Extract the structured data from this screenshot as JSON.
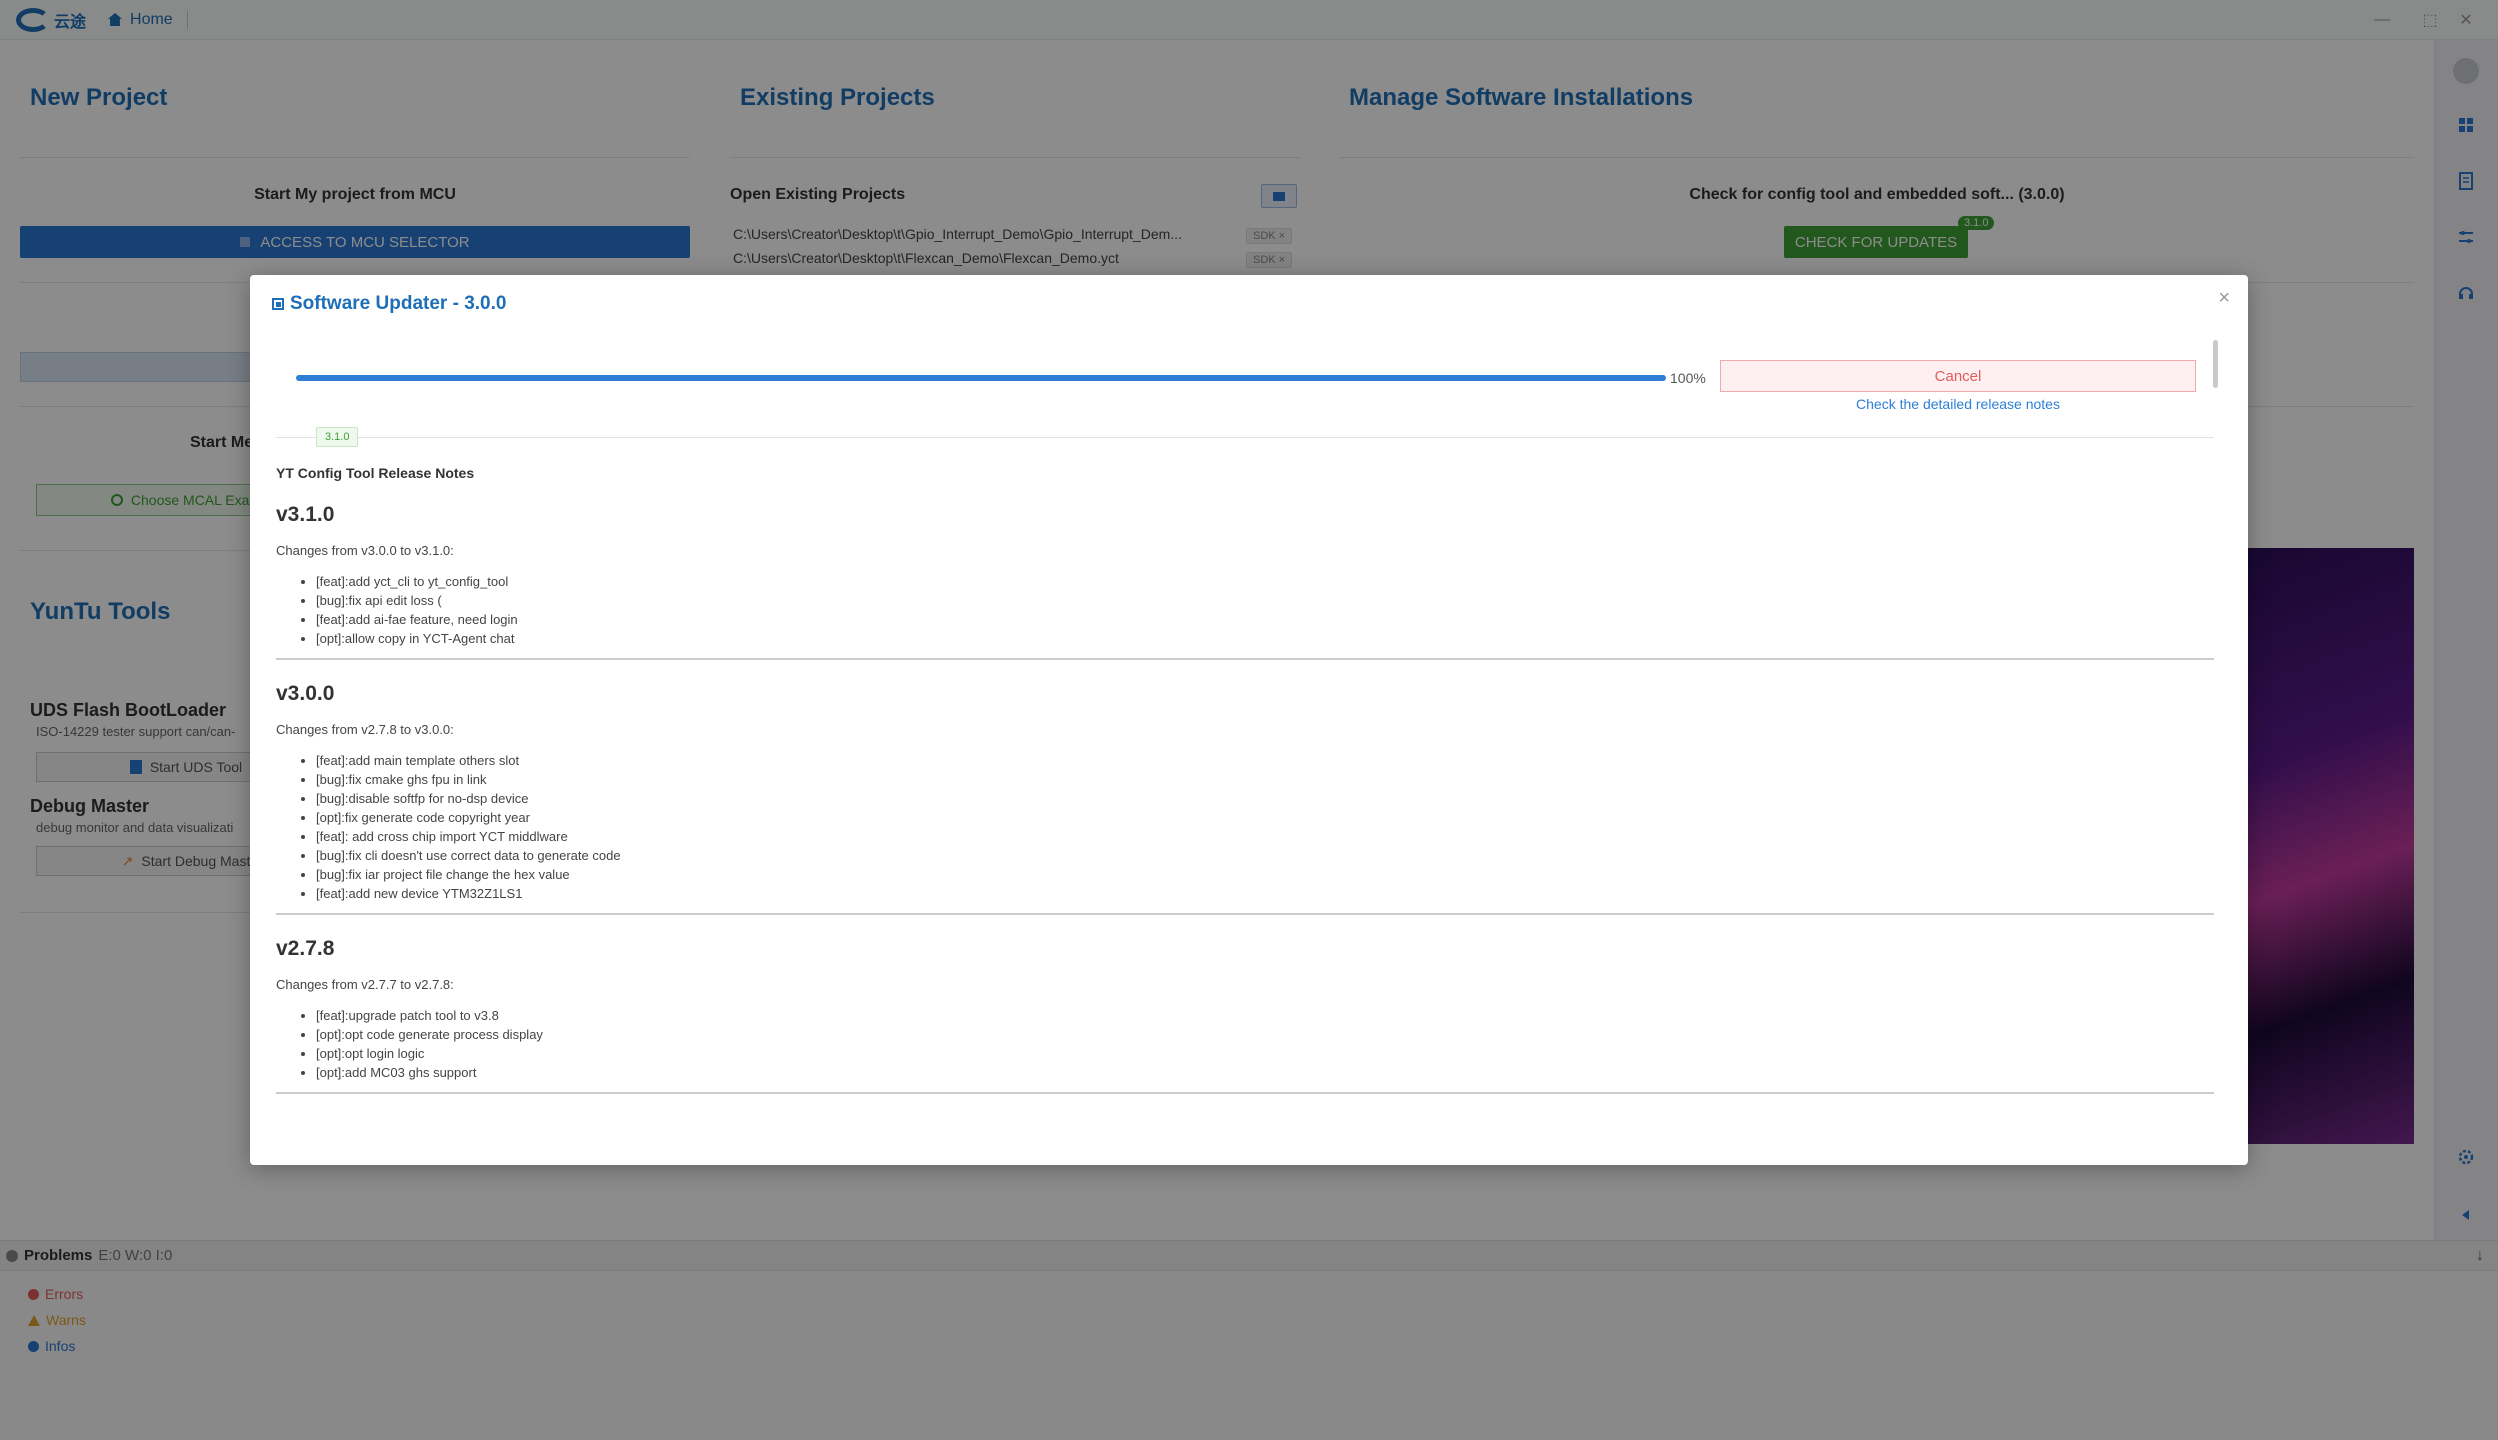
{
  "titlebar": {
    "logo_text": "云途",
    "home_label": "Home",
    "minimize": "—",
    "maximize": "⬚",
    "close": "✕"
  },
  "new_project": {
    "title": "New Project",
    "start_label": "Start My project from MCU",
    "mcu_button": "ACCESS TO MCU SELECTOR",
    "mcal_label": "Start Me",
    "mcal_button": "Choose MCAL Exam"
  },
  "existing_projects": {
    "title": "Existing Projects",
    "open_label": "Open Existing Projects",
    "projects": [
      {
        "path": "C:\\Users\\Creator\\Desktop\\t\\Gpio_Interrupt_Demo\\Gpio_Interrupt_Dem...",
        "tag": "SDK ×"
      },
      {
        "path": "C:\\Users\\Creator\\Desktop\\t\\Flexcan_Demo\\Flexcan_Demo.yct",
        "tag": "SDK ×"
      }
    ]
  },
  "manage_installations": {
    "title": "Manage Software Installations",
    "check_label": "Check for config tool and embedded soft... (3.0.0)",
    "check_button": "CHECK FOR UPDATES",
    "badge": "3.1.0"
  },
  "yuntu_tools": {
    "title": "YunTu Tools",
    "tools": [
      {
        "name": "UDS Flash BootLoader",
        "desc": "ISO-14229 tester support can/can-",
        "button": "Start UDS Tool"
      },
      {
        "name": "Debug Master",
        "desc": "debug monitor and data visualizati",
        "button": "Start Debug Mast"
      }
    ]
  },
  "problems": {
    "title": "Problems",
    "counts": "E:0 W:0 I:0",
    "errors": "Errors",
    "warns": "Warns",
    "infos": "Infos"
  },
  "dialog": {
    "title": "Software Updater - 3.0.0",
    "close": "×",
    "progress": 100,
    "progress_text": "100%",
    "cancel": "Cancel",
    "release_link": "Check the detailed release notes",
    "version_tag": "3.1.0",
    "notes_heading": "YT Config Tool Release Notes",
    "versions": [
      {
        "title": "v3.1.0",
        "changes": "Changes from v3.0.0 to v3.1.0:",
        "items": [
          "[feat]:add yct_cli to yt_config_tool",
          "[bug]:fix api edit loss (",
          "[feat]:add ai-fae feature, need login",
          "[opt]:allow copy in YCT-Agent chat"
        ]
      },
      {
        "title": "v3.0.0",
        "changes": "Changes from v2.7.8 to v3.0.0:",
        "items": [
          "[feat]:add main template others slot",
          "[bug]:fix cmake ghs fpu in link",
          "[bug]:disable softfp for no-dsp device",
          "[opt]:fix generate code copyright year",
          "[feat]: add cross chip import YCT middlware",
          "[bug]:fix cli doesn't use correct data to generate code",
          "[bug]:fix iar project file change the hex value",
          "[feat]:add new device YTM32Z1LS1"
        ]
      },
      {
        "title": "v2.7.8",
        "changes": "Changes from v2.7.7 to v2.7.8:",
        "items": [
          "[feat]:upgrade patch tool to v3.8",
          "[opt]:opt code generate process display",
          "[opt]:opt login logic",
          "[opt]:add MC03 ghs support"
        ]
      }
    ]
  },
  "colors": {
    "accent": "#1f6fb8",
    "primary_button": "#2d77d1",
    "success": "#3e9e36",
    "danger": "#e35b5b"
  }
}
